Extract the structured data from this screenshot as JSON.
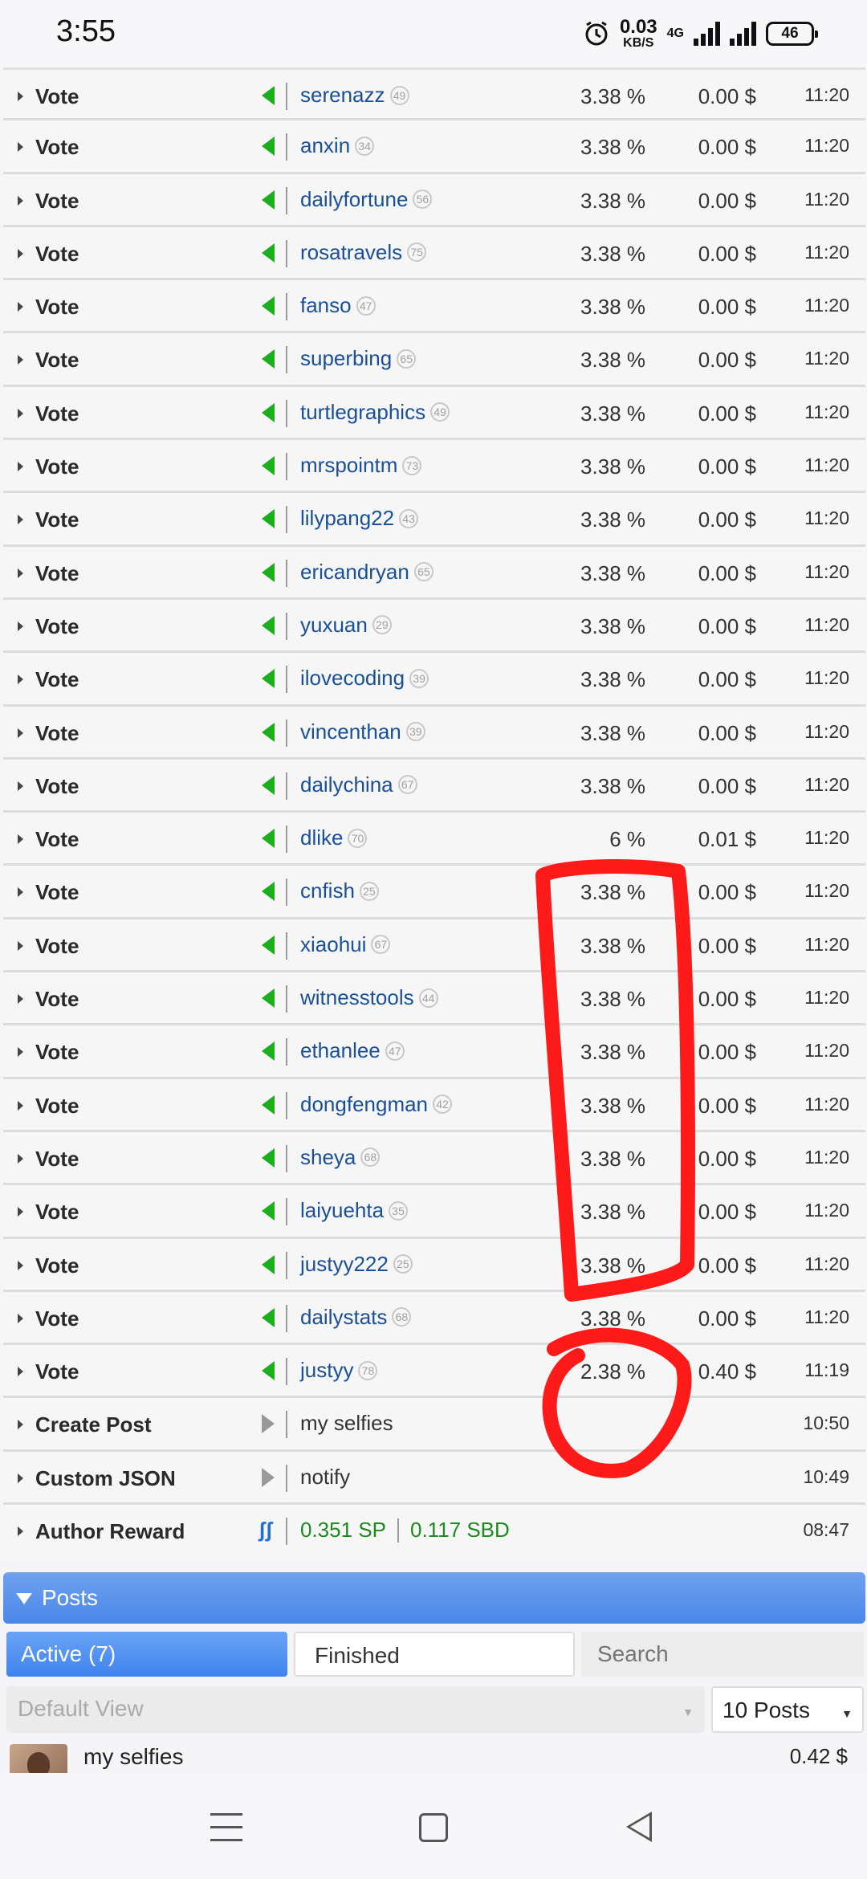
{
  "status_bar": {
    "time": "3:55",
    "net_speed": "0.03",
    "net_unit": "KB/S",
    "network_type": "4G",
    "battery": "46"
  },
  "operations": [
    {
      "type": "Vote",
      "user": "serenazz",
      "rep": "49",
      "percent": "3.38 %",
      "value": "0.00 $",
      "time": "11:20"
    },
    {
      "type": "Vote",
      "user": "anxin",
      "rep": "34",
      "percent": "3.38 %",
      "value": "0.00 $",
      "time": "11:20"
    },
    {
      "type": "Vote",
      "user": "dailyfortune",
      "rep": "56",
      "percent": "3.38 %",
      "value": "0.00 $",
      "time": "11:20"
    },
    {
      "type": "Vote",
      "user": "rosatravels",
      "rep": "75",
      "percent": "3.38 %",
      "value": "0.00 $",
      "time": "11:20"
    },
    {
      "type": "Vote",
      "user": "fanso",
      "rep": "47",
      "percent": "3.38 %",
      "value": "0.00 $",
      "time": "11:20"
    },
    {
      "type": "Vote",
      "user": "superbing",
      "rep": "65",
      "percent": "3.38 %",
      "value": "0.00 $",
      "time": "11:20"
    },
    {
      "type": "Vote",
      "user": "turtlegraphics",
      "rep": "49",
      "percent": "3.38 %",
      "value": "0.00 $",
      "time": "11:20"
    },
    {
      "type": "Vote",
      "user": "mrspointm",
      "rep": "73",
      "percent": "3.38 %",
      "value": "0.00 $",
      "time": "11:20"
    },
    {
      "type": "Vote",
      "user": "lilypang22",
      "rep": "43",
      "percent": "3.38 %",
      "value": "0.00 $",
      "time": "11:20"
    },
    {
      "type": "Vote",
      "user": "ericandryan",
      "rep": "65",
      "percent": "3.38 %",
      "value": "0.00 $",
      "time": "11:20"
    },
    {
      "type": "Vote",
      "user": "yuxuan",
      "rep": "29",
      "percent": "3.38 %",
      "value": "0.00 $",
      "time": "11:20"
    },
    {
      "type": "Vote",
      "user": "ilovecoding",
      "rep": "39",
      "percent": "3.38 %",
      "value": "0.00 $",
      "time": "11:20"
    },
    {
      "type": "Vote",
      "user": "vincenthan",
      "rep": "39",
      "percent": "3.38 %",
      "value": "0.00 $",
      "time": "11:20"
    },
    {
      "type": "Vote",
      "user": "dailychina",
      "rep": "67",
      "percent": "3.38 %",
      "value": "0.00 $",
      "time": "11:20"
    },
    {
      "type": "Vote",
      "user": "dlike",
      "rep": "70",
      "percent": "6 %",
      "value": "0.01 $",
      "time": "11:20"
    },
    {
      "type": "Vote",
      "user": "cnfish",
      "rep": "25",
      "percent": "3.38 %",
      "value": "0.00 $",
      "time": "11:20"
    },
    {
      "type": "Vote",
      "user": "xiaohui",
      "rep": "67",
      "percent": "3.38 %",
      "value": "0.00 $",
      "time": "11:20"
    },
    {
      "type": "Vote",
      "user": "witnesstools",
      "rep": "44",
      "percent": "3.38 %",
      "value": "0.00 $",
      "time": "11:20"
    },
    {
      "type": "Vote",
      "user": "ethanlee",
      "rep": "47",
      "percent": "3.38 %",
      "value": "0.00 $",
      "time": "11:20"
    },
    {
      "type": "Vote",
      "user": "dongfengman",
      "rep": "42",
      "percent": "3.38 %",
      "value": "0.00 $",
      "time": "11:20"
    },
    {
      "type": "Vote",
      "user": "sheya",
      "rep": "68",
      "percent": "3.38 %",
      "value": "0.00 $",
      "time": "11:20"
    },
    {
      "type": "Vote",
      "user": "laiyuehta",
      "rep": "35",
      "percent": "3.38 %",
      "value": "0.00 $",
      "time": "11:20"
    },
    {
      "type": "Vote",
      "user": "justyy222",
      "rep": "25",
      "percent": "3.38 %",
      "value": "0.00 $",
      "time": "11:20"
    },
    {
      "type": "Vote",
      "user": "dailystats",
      "rep": "68",
      "percent": "3.38 %",
      "value": "0.00 $",
      "time": "11:20"
    },
    {
      "type": "Vote",
      "user": "justyy",
      "rep": "78",
      "percent": "2.38 %",
      "value": "0.40 $",
      "time": "11:19"
    }
  ],
  "create_post": {
    "type": "Create Post",
    "memo": "my selfies",
    "time": "10:50"
  },
  "custom_json": {
    "type": "Custom JSON",
    "memo": "notify",
    "time": "10:49"
  },
  "author_reward": {
    "type": "Author Reward",
    "sp": "0.351 SP",
    "sbd": "0.117 SBD",
    "time": "08:47"
  },
  "posts": {
    "section_title": "Posts",
    "tab_active": "Active (7)",
    "tab_finished": "Finished",
    "search_placeholder": "Search",
    "view_select": "Default View",
    "count_select": "10 Posts",
    "first_post": {
      "title": "my selfies",
      "amount": "0.42 $"
    }
  },
  "colors": {
    "vote_icon": "#1bb01b",
    "username": "#1a4f99",
    "reward": "#1b8c1b",
    "posts_bar": "#4a86e8",
    "annotation": "#ff1a1a"
  }
}
